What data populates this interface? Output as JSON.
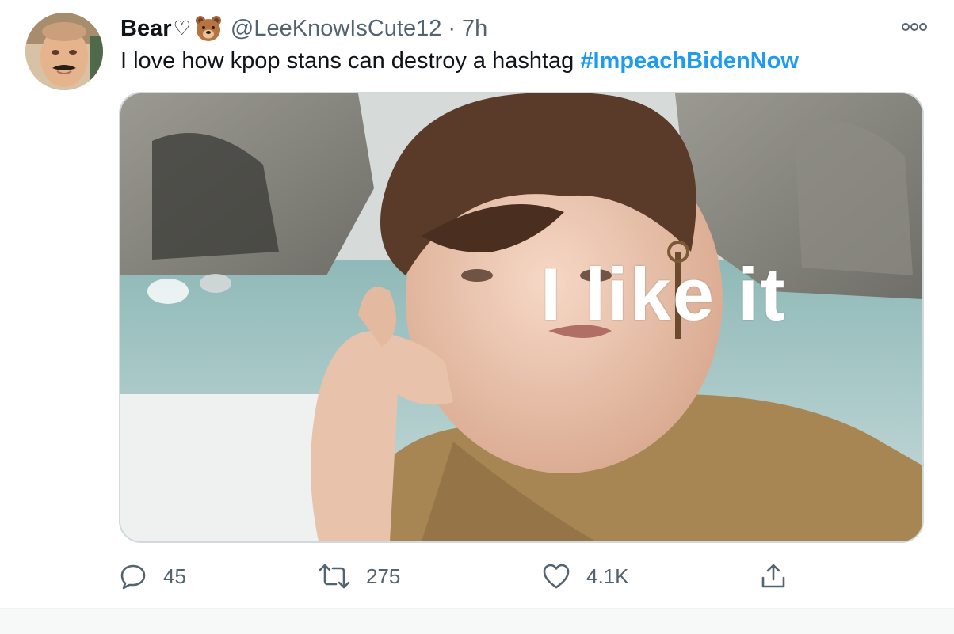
{
  "tweet": {
    "display_name": "Bear",
    "name_heart": "♡",
    "name_emoji": "bear-face-emoji",
    "handle": "@LeeKnowIsCute12",
    "separator": "·",
    "time": "7h",
    "text": "I love how kpop stans can destroy a hashtag ",
    "hashtag": "#ImpeachBidenNow",
    "media": {
      "caption": "I like it"
    }
  },
  "actions": {
    "replies": "45",
    "retweets": "275",
    "likes": "4.1K"
  },
  "colors": {
    "hashtag": "#1d9bf0",
    "secondary_text": "#536471",
    "border": "#cfd9de"
  },
  "icons": {
    "reply": "reply-icon",
    "retweet": "retweet-icon",
    "like": "like-icon",
    "share": "share-icon",
    "more": "more-options-icon"
  }
}
